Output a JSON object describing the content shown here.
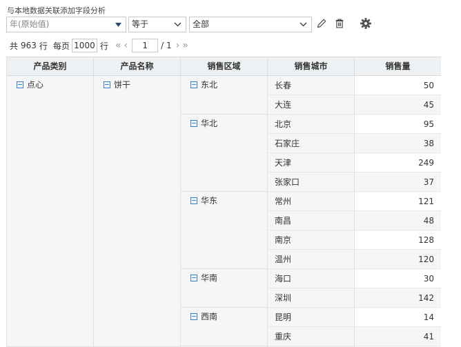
{
  "title": "与本地数据关联添加字段分析",
  "filter": {
    "field_placeholder": "年(原始值)",
    "operator": "等于",
    "value": "全部"
  },
  "pager": {
    "total_prefix": "共",
    "total": "963",
    "total_suffix": "行",
    "per_page_label": "每页",
    "page_size": "1000",
    "per_page_suffix": "行",
    "current_page": "1",
    "total_pages": "/ 1"
  },
  "table": {
    "headers": [
      "产品类别",
      "产品名称",
      "销售区域",
      "销售城市",
      "销售量"
    ],
    "category": "点心",
    "product": "饼干",
    "regions": [
      {
        "name": "东北",
        "rows": [
          {
            "city": "长春",
            "qty": "50"
          },
          {
            "city": "大连",
            "qty": "45"
          }
        ]
      },
      {
        "name": "华北",
        "rows": [
          {
            "city": "北京",
            "qty": "95"
          },
          {
            "city": "石家庄",
            "qty": "38"
          },
          {
            "city": "天津",
            "qty": "249"
          },
          {
            "city": "张家口",
            "qty": "37"
          }
        ]
      },
      {
        "name": "华东",
        "rows": [
          {
            "city": "常州",
            "qty": "121"
          },
          {
            "city": "南昌",
            "qty": "48"
          },
          {
            "city": "南京",
            "qty": "128"
          },
          {
            "city": "温州",
            "qty": "120"
          }
        ]
      },
      {
        "name": "华南",
        "rows": [
          {
            "city": "海口",
            "qty": "30"
          },
          {
            "city": "深圳",
            "qty": "142"
          }
        ]
      },
      {
        "name": "西南",
        "rows": [
          {
            "city": "昆明",
            "qty": "14"
          },
          {
            "city": "重庆",
            "qty": "41"
          }
        ]
      }
    ]
  },
  "icons": {
    "edit": "pencil-icon",
    "delete": "trash-icon",
    "settings": "gear-icon",
    "collapse": "minus-box-icon"
  },
  "colors": {
    "accent": "#3a7bd5",
    "header_bg": "#eef1f3",
    "cell_bg": "#f5f6f7"
  }
}
